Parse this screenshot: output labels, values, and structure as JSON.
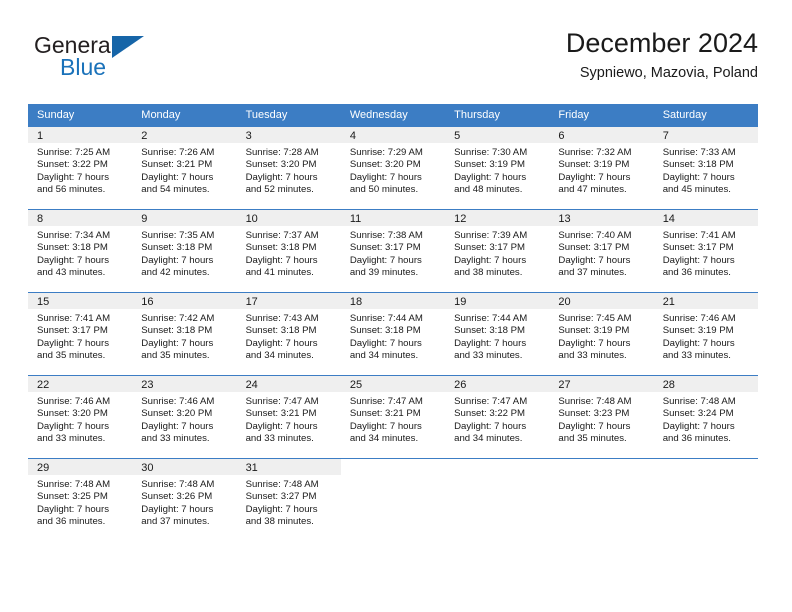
{
  "brand": {
    "name_part1": "General",
    "name_part2": "Blue",
    "logo_color": "#1665a8"
  },
  "header": {
    "title": "December 2024",
    "subtitle": "Sypniewo, Mazovia, Poland"
  },
  "theme": {
    "header_row_bg": "#3c7dc4",
    "date_band_bg": "#efefef",
    "text_color": "#1a1a1a"
  },
  "weekday_headers": [
    "Sunday",
    "Monday",
    "Tuesday",
    "Wednesday",
    "Thursday",
    "Friday",
    "Saturday"
  ],
  "weeks": [
    [
      {
        "date": "1",
        "sunrise": "Sunrise: 7:25 AM",
        "sunset": "Sunset: 3:22 PM",
        "daylight1": "Daylight: 7 hours",
        "daylight2": "and 56 minutes."
      },
      {
        "date": "2",
        "sunrise": "Sunrise: 7:26 AM",
        "sunset": "Sunset: 3:21 PM",
        "daylight1": "Daylight: 7 hours",
        "daylight2": "and 54 minutes."
      },
      {
        "date": "3",
        "sunrise": "Sunrise: 7:28 AM",
        "sunset": "Sunset: 3:20 PM",
        "daylight1": "Daylight: 7 hours",
        "daylight2": "and 52 minutes."
      },
      {
        "date": "4",
        "sunrise": "Sunrise: 7:29 AM",
        "sunset": "Sunset: 3:20 PM",
        "daylight1": "Daylight: 7 hours",
        "daylight2": "and 50 minutes."
      },
      {
        "date": "5",
        "sunrise": "Sunrise: 7:30 AM",
        "sunset": "Sunset: 3:19 PM",
        "daylight1": "Daylight: 7 hours",
        "daylight2": "and 48 minutes."
      },
      {
        "date": "6",
        "sunrise": "Sunrise: 7:32 AM",
        "sunset": "Sunset: 3:19 PM",
        "daylight1": "Daylight: 7 hours",
        "daylight2": "and 47 minutes."
      },
      {
        "date": "7",
        "sunrise": "Sunrise: 7:33 AM",
        "sunset": "Sunset: 3:18 PM",
        "daylight1": "Daylight: 7 hours",
        "daylight2": "and 45 minutes."
      }
    ],
    [
      {
        "date": "8",
        "sunrise": "Sunrise: 7:34 AM",
        "sunset": "Sunset: 3:18 PM",
        "daylight1": "Daylight: 7 hours",
        "daylight2": "and 43 minutes."
      },
      {
        "date": "9",
        "sunrise": "Sunrise: 7:35 AM",
        "sunset": "Sunset: 3:18 PM",
        "daylight1": "Daylight: 7 hours",
        "daylight2": "and 42 minutes."
      },
      {
        "date": "10",
        "sunrise": "Sunrise: 7:37 AM",
        "sunset": "Sunset: 3:18 PM",
        "daylight1": "Daylight: 7 hours",
        "daylight2": "and 41 minutes."
      },
      {
        "date": "11",
        "sunrise": "Sunrise: 7:38 AM",
        "sunset": "Sunset: 3:17 PM",
        "daylight1": "Daylight: 7 hours",
        "daylight2": "and 39 minutes."
      },
      {
        "date": "12",
        "sunrise": "Sunrise: 7:39 AM",
        "sunset": "Sunset: 3:17 PM",
        "daylight1": "Daylight: 7 hours",
        "daylight2": "and 38 minutes."
      },
      {
        "date": "13",
        "sunrise": "Sunrise: 7:40 AM",
        "sunset": "Sunset: 3:17 PM",
        "daylight1": "Daylight: 7 hours",
        "daylight2": "and 37 minutes."
      },
      {
        "date": "14",
        "sunrise": "Sunrise: 7:41 AM",
        "sunset": "Sunset: 3:17 PM",
        "daylight1": "Daylight: 7 hours",
        "daylight2": "and 36 minutes."
      }
    ],
    [
      {
        "date": "15",
        "sunrise": "Sunrise: 7:41 AM",
        "sunset": "Sunset: 3:17 PM",
        "daylight1": "Daylight: 7 hours",
        "daylight2": "and 35 minutes."
      },
      {
        "date": "16",
        "sunrise": "Sunrise: 7:42 AM",
        "sunset": "Sunset: 3:18 PM",
        "daylight1": "Daylight: 7 hours",
        "daylight2": "and 35 minutes."
      },
      {
        "date": "17",
        "sunrise": "Sunrise: 7:43 AM",
        "sunset": "Sunset: 3:18 PM",
        "daylight1": "Daylight: 7 hours",
        "daylight2": "and 34 minutes."
      },
      {
        "date": "18",
        "sunrise": "Sunrise: 7:44 AM",
        "sunset": "Sunset: 3:18 PM",
        "daylight1": "Daylight: 7 hours",
        "daylight2": "and 34 minutes."
      },
      {
        "date": "19",
        "sunrise": "Sunrise: 7:44 AM",
        "sunset": "Sunset: 3:18 PM",
        "daylight1": "Daylight: 7 hours",
        "daylight2": "and 33 minutes."
      },
      {
        "date": "20",
        "sunrise": "Sunrise: 7:45 AM",
        "sunset": "Sunset: 3:19 PM",
        "daylight1": "Daylight: 7 hours",
        "daylight2": "and 33 minutes."
      },
      {
        "date": "21",
        "sunrise": "Sunrise: 7:46 AM",
        "sunset": "Sunset: 3:19 PM",
        "daylight1": "Daylight: 7 hours",
        "daylight2": "and 33 minutes."
      }
    ],
    [
      {
        "date": "22",
        "sunrise": "Sunrise: 7:46 AM",
        "sunset": "Sunset: 3:20 PM",
        "daylight1": "Daylight: 7 hours",
        "daylight2": "and 33 minutes."
      },
      {
        "date": "23",
        "sunrise": "Sunrise: 7:46 AM",
        "sunset": "Sunset: 3:20 PM",
        "daylight1": "Daylight: 7 hours",
        "daylight2": "and 33 minutes."
      },
      {
        "date": "24",
        "sunrise": "Sunrise: 7:47 AM",
        "sunset": "Sunset: 3:21 PM",
        "daylight1": "Daylight: 7 hours",
        "daylight2": "and 33 minutes."
      },
      {
        "date": "25",
        "sunrise": "Sunrise: 7:47 AM",
        "sunset": "Sunset: 3:21 PM",
        "daylight1": "Daylight: 7 hours",
        "daylight2": "and 34 minutes."
      },
      {
        "date": "26",
        "sunrise": "Sunrise: 7:47 AM",
        "sunset": "Sunset: 3:22 PM",
        "daylight1": "Daylight: 7 hours",
        "daylight2": "and 34 minutes."
      },
      {
        "date": "27",
        "sunrise": "Sunrise: 7:48 AM",
        "sunset": "Sunset: 3:23 PM",
        "daylight1": "Daylight: 7 hours",
        "daylight2": "and 35 minutes."
      },
      {
        "date": "28",
        "sunrise": "Sunrise: 7:48 AM",
        "sunset": "Sunset: 3:24 PM",
        "daylight1": "Daylight: 7 hours",
        "daylight2": "and 36 minutes."
      }
    ],
    [
      {
        "date": "29",
        "sunrise": "Sunrise: 7:48 AM",
        "sunset": "Sunset: 3:25 PM",
        "daylight1": "Daylight: 7 hours",
        "daylight2": "and 36 minutes."
      },
      {
        "date": "30",
        "sunrise": "Sunrise: 7:48 AM",
        "sunset": "Sunset: 3:26 PM",
        "daylight1": "Daylight: 7 hours",
        "daylight2": "and 37 minutes."
      },
      {
        "date": "31",
        "sunrise": "Sunrise: 7:48 AM",
        "sunset": "Sunset: 3:27 PM",
        "daylight1": "Daylight: 7 hours",
        "daylight2": "and 38 minutes."
      },
      {
        "date": "",
        "sunrise": "",
        "sunset": "",
        "daylight1": "",
        "daylight2": ""
      },
      {
        "date": "",
        "sunrise": "",
        "sunset": "",
        "daylight1": "",
        "daylight2": ""
      },
      {
        "date": "",
        "sunrise": "",
        "sunset": "",
        "daylight1": "",
        "daylight2": ""
      },
      {
        "date": "",
        "sunrise": "",
        "sunset": "",
        "daylight1": "",
        "daylight2": ""
      }
    ]
  ]
}
